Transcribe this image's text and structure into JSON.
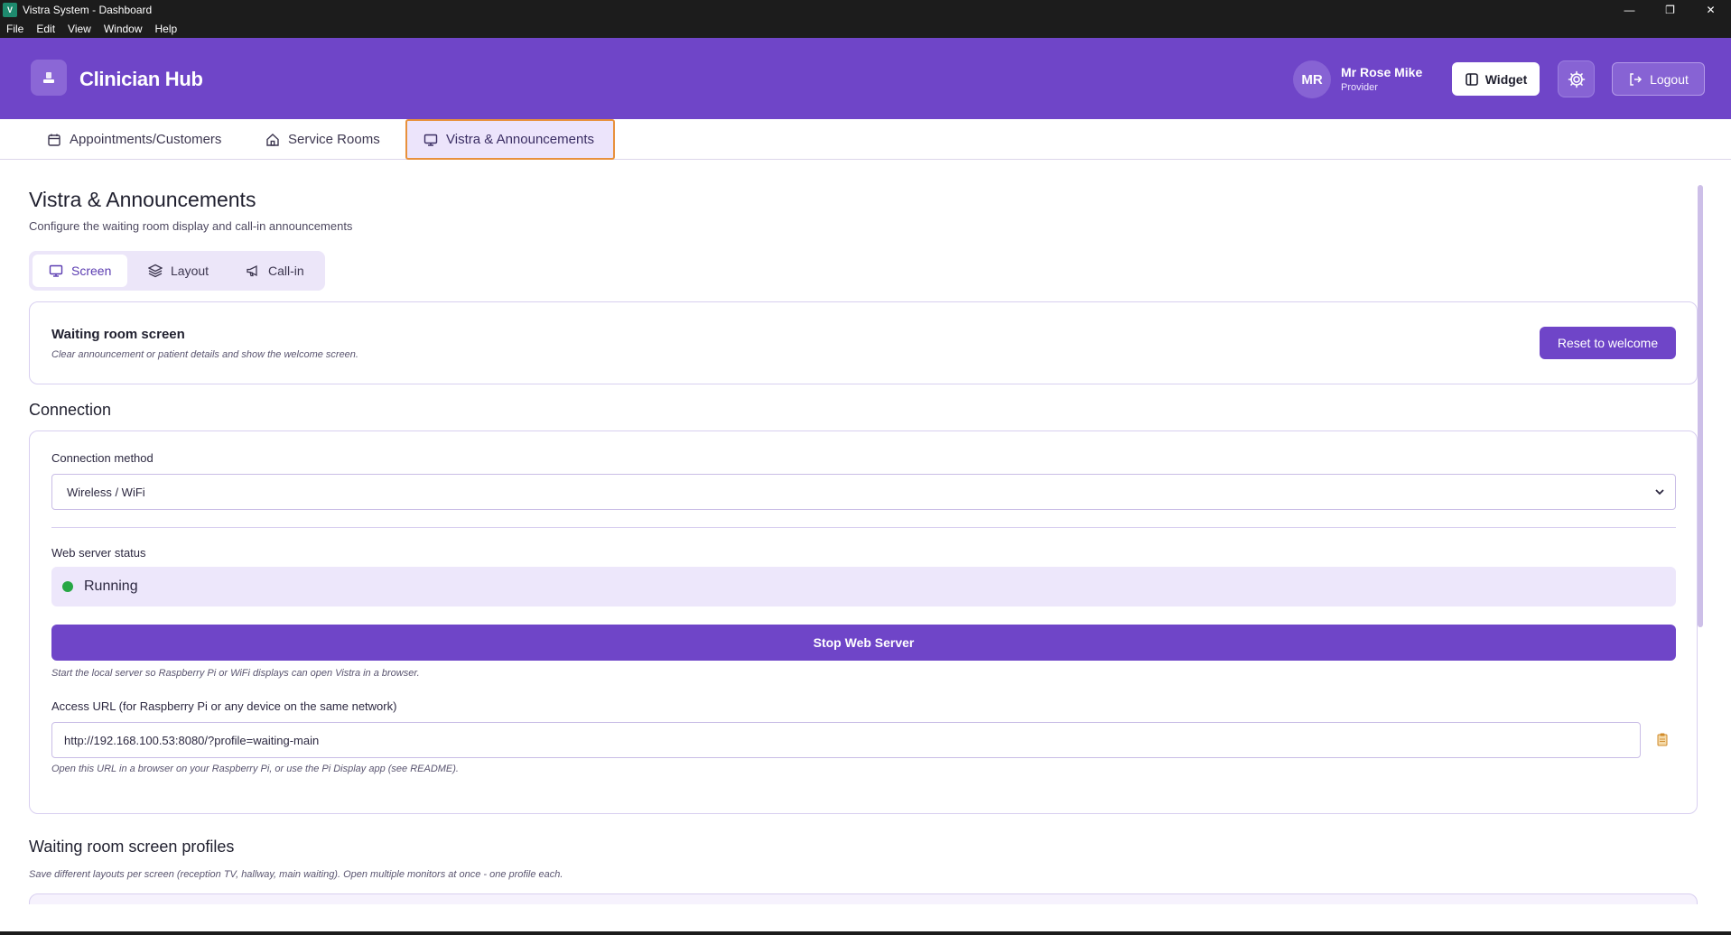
{
  "window": {
    "title": "Vistra System - Dashboard",
    "controls": {
      "minimize": "—",
      "maximize": "❐",
      "close": "✕"
    }
  },
  "menu": [
    "File",
    "Edit",
    "View",
    "Window",
    "Help"
  ],
  "header": {
    "brand": "Clinician Hub",
    "user_initials": "MR",
    "user_name": "Mr Rose Mike",
    "user_role": "Provider",
    "widget_label": "Widget",
    "logout_label": "Logout"
  },
  "tabs": [
    {
      "label": "Appointments/Customers",
      "icon": "calendar-icon"
    },
    {
      "label": "Service Rooms",
      "icon": "home-icon"
    },
    {
      "label": "Vistra & Announcements",
      "icon": "monitor-icon",
      "active": true
    }
  ],
  "page": {
    "title": "Vistra & Announcements",
    "subtitle": "Configure the waiting room display and call-in announcements",
    "subtabs": [
      {
        "label": "Screen",
        "icon": "monitor-icon",
        "active": true
      },
      {
        "label": "Layout",
        "icon": "layers-icon"
      },
      {
        "label": "Call-in",
        "icon": "megaphone-icon"
      }
    ]
  },
  "waiting_screen": {
    "title": "Waiting room screen",
    "description": "Clear announcement or patient details and show the welcome screen.",
    "reset_label": "Reset to welcome"
  },
  "connection": {
    "section_title": "Connection",
    "method_label": "Connection method",
    "method_value": "Wireless / WiFi",
    "status_label": "Web server status",
    "status_value": "Running",
    "status_color": "#27a745",
    "stop_label": "Stop Web Server",
    "stop_hint": "Start the local server so Raspberry Pi or WiFi displays can open Vistra in a browser.",
    "url_label": "Access URL (for Raspberry Pi or any device on the same network)",
    "url_value": "http://192.168.100.53:8080/?profile=waiting-main",
    "url_hint": "Open this URL in a browser on your Raspberry Pi, or use the Pi Display app (see README)."
  },
  "profiles": {
    "title": "Waiting room screen profiles",
    "subtitle": "Save different layouts per screen (reception TV, hallway, main waiting). Open multiple monitors at once - one profile each."
  },
  "colors": {
    "brand_purple": "#6f45c8",
    "active_tab_border": "#e8913c"
  }
}
